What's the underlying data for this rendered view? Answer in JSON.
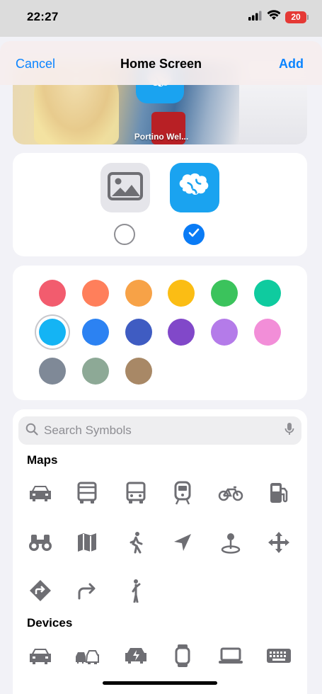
{
  "status_bar": {
    "time": "22:27",
    "battery": "20"
  },
  "nav": {
    "cancel_label": "Cancel",
    "title": "Home Screen",
    "add_label": "Add"
  },
  "preview": {
    "app_label": "Portino Wel..."
  },
  "colors": {
    "selected": "light-blue",
    "swatches": [
      {
        "name": "red",
        "hex": "#f25c6e"
      },
      {
        "name": "coral",
        "hex": "#ff7f5b"
      },
      {
        "name": "orange",
        "hex": "#f7a247"
      },
      {
        "name": "yellow",
        "hex": "#fbbd14"
      },
      {
        "name": "green",
        "hex": "#3bc35c"
      },
      {
        "name": "teal",
        "hex": "#0fcb9f"
      },
      {
        "name": "light-blue",
        "hex": "#14b4f4"
      },
      {
        "name": "blue",
        "hex": "#2c82f2"
      },
      {
        "name": "indigo",
        "hex": "#3f5cc2"
      },
      {
        "name": "purple",
        "hex": "#8148c9"
      },
      {
        "name": "lavender",
        "hex": "#b47be9"
      },
      {
        "name": "pink",
        "hex": "#f28ed8"
      },
      {
        "name": "gray",
        "hex": "#7f8997"
      },
      {
        "name": "sage",
        "hex": "#8da996"
      },
      {
        "name": "brown",
        "hex": "#a88866"
      }
    ]
  },
  "symbols": {
    "search_placeholder": "Search Symbols",
    "sections": [
      {
        "title": "Maps",
        "icons": [
          "car-icon",
          "bus-icon",
          "bus-front-icon",
          "tram-icon",
          "bicycle-icon",
          "fuel-pump-icon",
          "binoculars-icon",
          "map-icon",
          "walking-person-icon",
          "location-arrow-icon",
          "map-pin-icon",
          "move-arrows-icon",
          "directions-sign-icon",
          "turn-right-arrow-icon",
          "standing-person-icon"
        ]
      },
      {
        "title": "Devices",
        "icons": [
          "car-icon",
          "two-cars-icon",
          "electric-car-icon",
          "watch-icon",
          "laptop-icon",
          "keyboard-icon"
        ]
      }
    ]
  }
}
